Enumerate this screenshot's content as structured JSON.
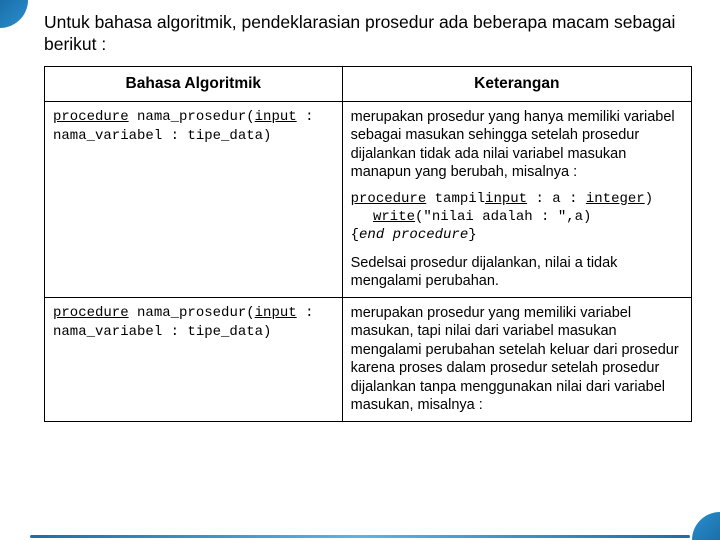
{
  "title": "Untuk bahasa  algoritmik,  pendeklarasian prosedur  ada  beberapa macam sebagai berikut :",
  "table": {
    "headers": {
      "col1": "Bahasa Algoritmik",
      "col2": "Keterangan"
    },
    "rows": [
      {
        "bahasa": {
          "kw_proc": "procedure",
          "name": " nama_prosedur(",
          "kw_input": "input",
          "after_input": " : nama_variabel : tipe_data)"
        },
        "ket": {
          "para1": "merupakan prosedur yang hanya memiliki variabel sebagai masukan sehingga setelah prosedur dijalankan tidak ada nilai variabel masukan manapun yang berubah, misalnya :",
          "code": {
            "kw_proc": "procedure",
            "mid1": " tampil",
            "kw_input": "input",
            "mid2": " : a : ",
            "kw_integer": "integer",
            "close_paren": ")",
            "kw_write": "write",
            "write_args": "(\"nilai adalah : \",a)",
            "end_open": "{",
            "end_text": "end procedure",
            "end_close": "}"
          },
          "para2": "Sedelsai prosedur dijalankan, nilai a tidak mengalami perubahan."
        }
      },
      {
        "bahasa": {
          "kw_proc": "procedure",
          "name": " nama_prosedur(",
          "kw_input": "input",
          "after_input": " : nama_variabel : tipe_data)"
        },
        "ket": {
          "para1": "merupakan prosedur yang memiliki variabel masukan, tapi nilai dari variabel masukan mengalami perubahan setelah keluar dari prosedur karena proses dalam prosedur setelah prosedur dijalankan tanpa menggunakan nilai dari variabel masukan, misalnya :"
        }
      }
    ]
  }
}
